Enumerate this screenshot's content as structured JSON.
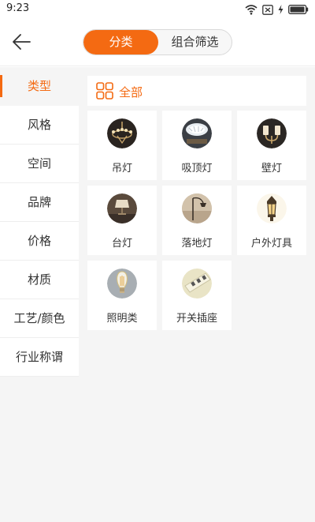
{
  "status_bar": {
    "time": "9:23"
  },
  "header": {
    "segment_tabs": [
      {
        "label": "分类",
        "active": true
      },
      {
        "label": "组合筛选",
        "active": false
      }
    ]
  },
  "sidebar": {
    "items": [
      {
        "label": "类型",
        "active": true
      },
      {
        "label": "风格"
      },
      {
        "label": "空间"
      },
      {
        "label": "品牌"
      },
      {
        "label": "价格"
      },
      {
        "label": "材质"
      },
      {
        "label": "工艺/颜色"
      },
      {
        "label": "行业称谓"
      }
    ]
  },
  "content": {
    "all_label": "全部",
    "categories": [
      {
        "label": "吊灯",
        "icon": "chandelier-icon"
      },
      {
        "label": "吸顶灯",
        "icon": "ceiling-light-icon"
      },
      {
        "label": "壁灯",
        "icon": "wall-lamp-icon"
      },
      {
        "label": "台灯",
        "icon": "table-lamp-icon"
      },
      {
        "label": "落地灯",
        "icon": "floor-lamp-icon"
      },
      {
        "label": "户外灯具",
        "icon": "outdoor-lantern-icon"
      },
      {
        "label": "照明类",
        "icon": "light-bulb-icon"
      },
      {
        "label": "开关插座",
        "icon": "switch-socket-icon"
      }
    ]
  },
  "colors": {
    "accent": "#f46a12",
    "background": "#f5f5f5",
    "text": "#333333"
  }
}
